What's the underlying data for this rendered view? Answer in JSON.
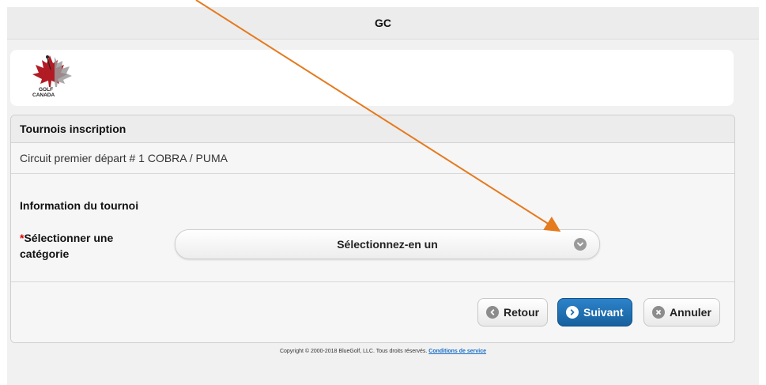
{
  "app": {
    "title": "GC"
  },
  "logo": {
    "line1": "GOLF",
    "line2": "CANADA"
  },
  "panel": {
    "header": "Tournois inscription",
    "tournament_name": "Circuit premier départ # 1 COBRA / PUMA",
    "section_title": "Information du tournoi",
    "category_field": {
      "required_marker": "*",
      "label": "Sélectionner une catégorie",
      "selected_value": "Sélectionnez-en un"
    }
  },
  "buttons": {
    "back": "Retour",
    "next": "Suivant",
    "cancel": "Annuler"
  },
  "footer": {
    "copyright": "Copyright © 2000-2018 BlueGolf, LLC. Tous droits réservés.",
    "terms_link": "Conditions de service"
  },
  "colors": {
    "accent": "#1f6fb2",
    "annotation_arrow": "#e57a1e",
    "required": "#dd0000"
  },
  "icons": {
    "select": "chevron-down-icon",
    "back": "chevron-left-icon",
    "next": "chevron-right-icon",
    "cancel": "close-icon"
  }
}
